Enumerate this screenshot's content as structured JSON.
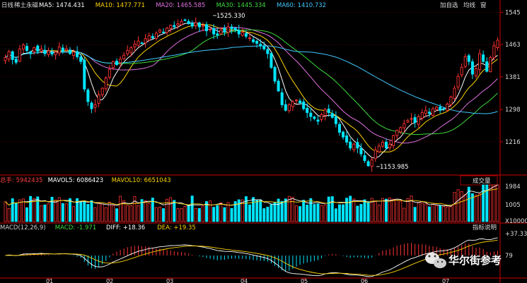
{
  "header": {
    "period": "日线",
    "name": "稀土永磁",
    "ma_items": [
      {
        "label": "MA5: 1474.431",
        "color": "#ffffff"
      },
      {
        "label": "MA10: 1477.771",
        "color": "#ffd400"
      },
      {
        "label": "MA20: 1465.585",
        "color": "#e070e0"
      },
      {
        "label": "MA30: 1445.334",
        "color": "#3ddc3d"
      },
      {
        "label": "MA60: 1410.732",
        "color": "#40c8ff"
      }
    ],
    "toolbar": [
      "加自选",
      "均线",
      "窗"
    ]
  },
  "price_axis": {
    "ticks": [
      1545,
      1463,
      1381,
      1298,
      1216
    ],
    "ylim": [
      1135,
      1553
    ]
  },
  "annotations": {
    "high": "1525.330",
    "low": "1153.985"
  },
  "volume": {
    "legend": [
      {
        "label": "总手: 5942435",
        "color": "#ff4040"
      },
      {
        "label": "MAVOL5: 6086423",
        "color": "#ffffff"
      },
      {
        "label": "MAVOL10: 6651043",
        "color": "#ffd400"
      }
    ],
    "tab": "成交量",
    "ticks": [
      "1984",
      "1005",
      "X10000"
    ]
  },
  "macd": {
    "legend": [
      {
        "label": "MACD(12,26,9)",
        "color": "#cccccc"
      },
      {
        "label": "MACD: -1.971",
        "color": "#3ddc3d"
      },
      {
        "label": "DIFF: +18.36",
        "color": "#ffffff"
      },
      {
        "label": "DEA: +19.35",
        "color": "#ffd400"
      }
    ],
    "tab": "指标说明",
    "ticks": [
      "+37.33",
      "79"
    ]
  },
  "x_axis": {
    "months": [
      "01",
      "02",
      "03",
      "04",
      "05",
      "06",
      "07"
    ]
  },
  "watermark": {
    "text": "华尔街参考"
  },
  "colors": {
    "up": "#ff3333",
    "down": "#00e5ff",
    "grid": "#a00000",
    "axis": "#cc0000"
  },
  "chart_data": {
    "type": "candlestick",
    "title": "稀土永磁 日线",
    "ylim": [
      1135,
      1553
    ],
    "price_path": [
      1430,
      1445,
      1425,
      1418,
      1452,
      1462,
      1448,
      1440,
      1455,
      1446,
      1452,
      1440,
      1447,
      1439,
      1444,
      1457,
      1446,
      1452,
      1440,
      1444,
      1432,
      1420,
      1350,
      1318,
      1300,
      1310,
      1335,
      1352,
      1378,
      1400,
      1420,
      1412,
      1426,
      1436,
      1448,
      1455,
      1464,
      1472,
      1467,
      1478,
      1486,
      1480,
      1492,
      1500,
      1495,
      1505,
      1512,
      1508,
      1516,
      1522,
      1525,
      1516,
      1510,
      1519,
      1508,
      1512,
      1498,
      1502,
      1490,
      1487,
      1500,
      1495,
      1508,
      1503,
      1500,
      1490,
      1494,
      1484,
      1480,
      1470,
      1466,
      1460,
      1452,
      1440,
      1405,
      1370,
      1345,
      1310,
      1296,
      1310,
      1318,
      1322,
      1315,
      1300,
      1290,
      1280,
      1275,
      1268,
      1285,
      1298,
      1290,
      1278,
      1262,
      1240,
      1228,
      1215,
      1200,
      1210,
      1200,
      1185,
      1168,
      1155,
      1170,
      1195,
      1205,
      1215,
      1200,
      1210,
      1232,
      1245,
      1252,
      1262,
      1270,
      1275,
      1265,
      1280,
      1290,
      1295,
      1288,
      1300,
      1304,
      1296,
      1300,
      1312,
      1330,
      1352,
      1382,
      1405,
      1432,
      1420,
      1388,
      1402,
      1440,
      1420,
      1395,
      1430,
      1460,
      1474
    ],
    "price_path_note": "approximate closing-level path spanning 01→07 (left to right)",
    "series": [
      {
        "name": "MA5",
        "value": 1474.431
      },
      {
        "name": "MA10",
        "value": 1477.771
      },
      {
        "name": "MA20",
        "value": 1465.585
      },
      {
        "name": "MA30",
        "value": 1445.334
      },
      {
        "name": "MA60",
        "value": 1410.732
      }
    ],
    "volume_scale": [
      "1984",
      "1005",
      "X10000"
    ],
    "high": 1525.33,
    "low": 1153.985
  }
}
